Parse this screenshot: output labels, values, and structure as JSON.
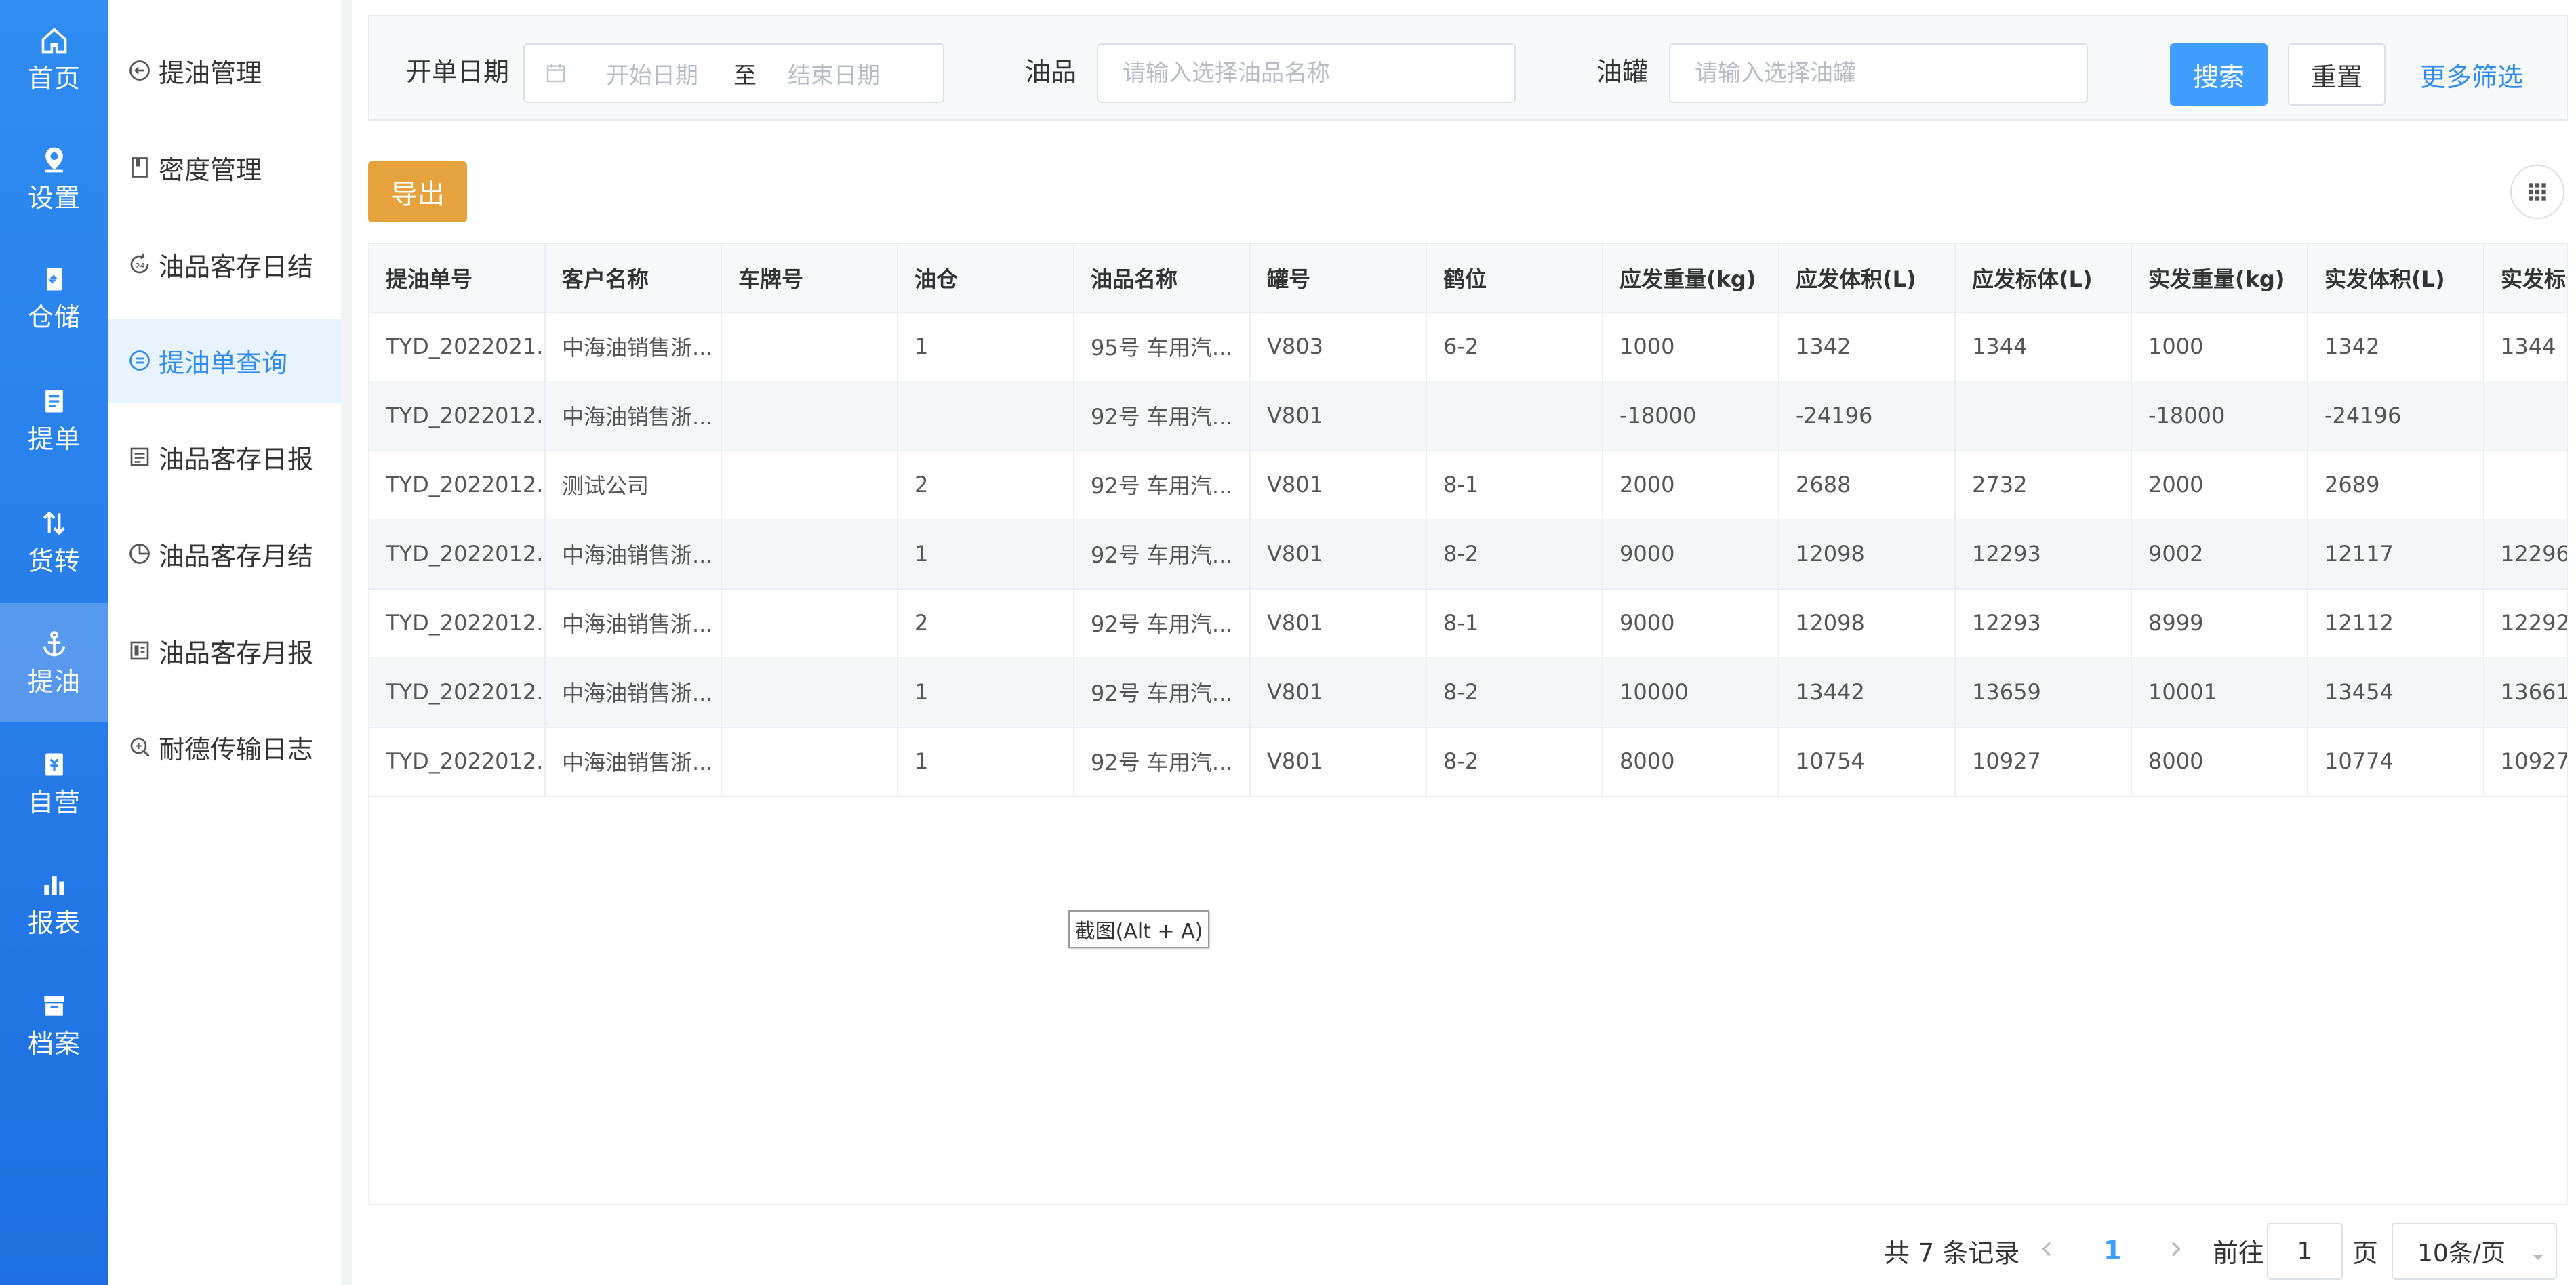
{
  "primary_nav": [
    {
      "label": "首页",
      "icon": "home-icon"
    },
    {
      "label": "设置",
      "icon": "location-pin-icon"
    },
    {
      "label": "仓储",
      "icon": "warehouse-icon"
    },
    {
      "label": "提单",
      "icon": "document-icon"
    },
    {
      "label": "货转",
      "icon": "transfer-icon"
    },
    {
      "label": "提油",
      "icon": "anchor-icon"
    },
    {
      "label": "自营",
      "icon": "bookmark-icon"
    },
    {
      "label": "报表",
      "icon": "bar-chart-icon"
    },
    {
      "label": "档案",
      "icon": "archive-icon"
    }
  ],
  "sub_menu": [
    {
      "label": "提油管理",
      "icon": "return-icon"
    },
    {
      "label": "密度管理",
      "icon": "book-icon"
    },
    {
      "label": "油品客存日结",
      "icon": "cycle-24h-icon"
    },
    {
      "label": "提油单查询",
      "icon": "list-circle-icon"
    },
    {
      "label": "油品客存日报",
      "icon": "daily-report-icon"
    },
    {
      "label": "油品客存月结",
      "icon": "pie-icon"
    },
    {
      "label": "油品客存月报",
      "icon": "monthly-report-icon"
    },
    {
      "label": "耐德传输日志",
      "icon": "search-log-icon"
    }
  ],
  "filters": {
    "date_label": "开单日期",
    "start_placeholder": "开始日期",
    "range_separator": "至",
    "end_placeholder": "结束日期",
    "product_label": "油品",
    "product_placeholder": "请输入选择油品名称",
    "tank_label": "油罐",
    "tank_placeholder": "请输入选择油罐",
    "search_button": "搜索",
    "reset_button": "重置",
    "more_filters": "更多筛选"
  },
  "toolbar": {
    "export_button": "导出"
  },
  "table": {
    "columns": [
      "提油单号",
      "客户名称",
      "车牌号",
      "油仓",
      "油品名称",
      "罐号",
      "鹤位",
      "应发重量(kg)",
      "应发体积(L)",
      "应发标体(L)",
      "实发重量(kg)",
      "实发体积(L)",
      "实发标体"
    ],
    "rows": [
      [
        "TYD_2022021...",
        "中海油销售浙...",
        "",
        "1",
        "95号 车用汽...",
        "V803",
        "6-2",
        "1000",
        "1342",
        "1344",
        "1000",
        "1342",
        "1344"
      ],
      [
        "TYD_2022012...",
        "中海油销售浙...",
        "",
        "",
        "92号 车用汽...",
        "V801",
        "",
        "-18000",
        "-24196",
        "",
        "-18000",
        "-24196",
        ""
      ],
      [
        "TYD_2022012...",
        "测试公司",
        "",
        "2",
        "92号 车用汽...",
        "V801",
        "8-1",
        "2000",
        "2688",
        "2732",
        "2000",
        "2689",
        ""
      ],
      [
        "TYD_2022012...",
        "中海油销售浙...",
        "",
        "1",
        "92号 车用汽...",
        "V801",
        "8-2",
        "9000",
        "12098",
        "12293",
        "9002",
        "12117",
        "12296"
      ],
      [
        "TYD_2022012...",
        "中海油销售浙...",
        "",
        "2",
        "92号 车用汽...",
        "V801",
        "8-1",
        "9000",
        "12098",
        "12293",
        "8999",
        "12112",
        "12292"
      ],
      [
        "TYD_2022012...",
        "中海油销售浙...",
        "",
        "1",
        "92号 车用汽...",
        "V801",
        "8-2",
        "10000",
        "13442",
        "13659",
        "10001",
        "13454",
        "13661"
      ],
      [
        "TYD_2022012...",
        "中海油销售浙...",
        "",
        "1",
        "92号 车用汽...",
        "V801",
        "8-2",
        "8000",
        "10754",
        "10927",
        "8000",
        "10774",
        "10927"
      ]
    ]
  },
  "tooltip": "截图(Alt + A)",
  "pagination": {
    "total_text": "共 7 条记录",
    "current_page": "1",
    "goto_label": "前往",
    "goto_value": "1",
    "page_suffix": "页",
    "page_size": "10条/页"
  },
  "colors": {
    "nav_blue": "#2f8cf1",
    "primary": "#409eff",
    "export_orange": "#e6a23c",
    "active_bg": "#e8f3ff"
  }
}
